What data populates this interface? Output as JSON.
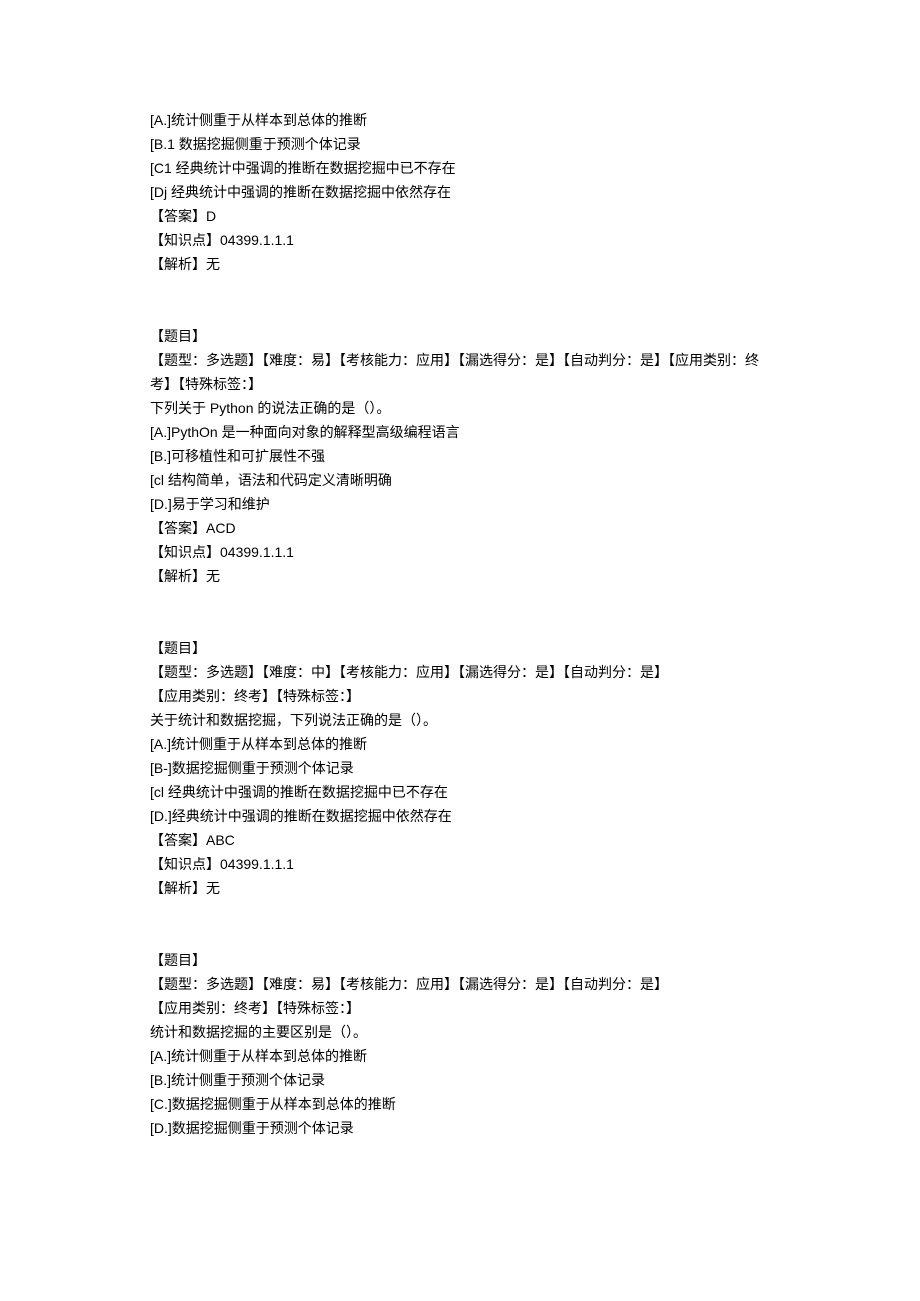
{
  "blocks": [
    {
      "lines": [
        "[A.]统计侧重于从样本到总体的推断",
        "[B.1 数据挖掘侧重于预测个体记录",
        "[C1 经典统计中强调的推断在数据挖掘中已不存在",
        "[Dj 经典统计中强调的推断在数据挖掘中依然存在",
        "【答案】D",
        "【知识点】04399.1.1.1",
        "【解析】无"
      ]
    },
    {
      "lines": [
        "【题目】",
        "【题型：多选题】【难度：易】【考核能力：应用】【漏选得分：是】【自动判分：是】【应用类别：终考】【特殊标签：】",
        "下列关于 Python 的说法正确的是（）。",
        "[A.]PythOn 是一种面向对象的解释型高级编程语言",
        "[B.]可移植性和可扩展性不强",
        "[cl 结构简单，语法和代码定义清晰明确",
        "[D.]易于学习和维护",
        "【答案】ACD",
        "【知识点】04399.1.1.1",
        "【解析】无"
      ]
    },
    {
      "lines": [
        "【题目】",
        "【题型：多选题】【难度：中】【考核能力：应用】【漏选得分：是】【自动判分：是】",
        "【应用类别：终考】【特殊标签：】",
        "关于统计和数据挖掘，下列说法正确的是（）。",
        "[A.]统计侧重于从样本到总体的推断",
        "[B-]数据挖掘侧重于预测个体记录",
        "[cl 经典统计中强调的推断在数据挖掘中已不存在",
        "[D.]经典统计中强调的推断在数据挖掘中依然存在",
        "【答案】ABC",
        "【知识点】04399.1.1.1",
        "【解析】无"
      ]
    },
    {
      "lines": [
        "【题目】",
        "【题型：多选题】【难度：易】【考核能力：应用】【漏选得分：是】【自动判分：是】",
        "【应用类别：终考】【特殊标签：】",
        "统计和数据挖掘的主要区别是（）。",
        "[A.]统计侧重于从样本到总体的推断",
        "[B.]统计侧重于预测个体记录",
        "[C.]数据挖掘侧重于从样本到总体的推断",
        "[D.]数据挖掘侧重于预测个体记录"
      ]
    }
  ]
}
